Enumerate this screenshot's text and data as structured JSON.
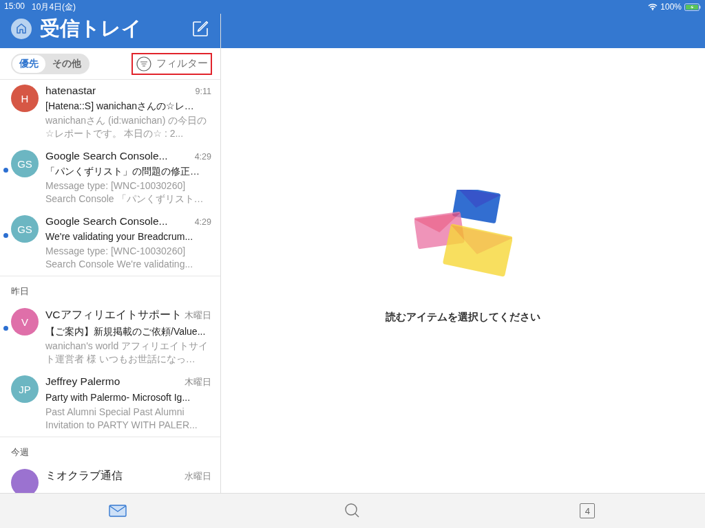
{
  "status_bar": {
    "time": "15:00",
    "date": "10月4日(金)",
    "battery": "100%"
  },
  "mail_pane": {
    "title": "受信トレイ",
    "segments": [
      {
        "label": "優先",
        "selected": true
      },
      {
        "label": "その他",
        "selected": false
      }
    ],
    "filter": {
      "label": "フィルター",
      "highlighted": true
    },
    "sections": [
      {
        "messages": [
          {
            "initials": "H",
            "color": "#d65745",
            "sender": "hatenastar",
            "time": "9:11",
            "subject": "[Hatena::S] wanichanさんの☆レ…",
            "preview": "wanichanさん (id:wanichan) の今日の☆レポートです。 本日の☆ : 2...",
            "unread": false
          },
          {
            "initials": "GS",
            "color": "#6cb6c2",
            "sender": "Google Search Console...",
            "time": "4:29",
            "subject": "「パンくずリスト」の問題の修正…",
            "preview": "Message type: [WNC-10030260] Search Console 「パンくずリスト…",
            "unread": true
          },
          {
            "initials": "GS",
            "color": "#6cb6c2",
            "sender": "Google Search Console...",
            "time": "4:29",
            "subject": "We're validating your Breadcrum...",
            "preview": "Message type: [WNC-10030260] Search Console We're validating...",
            "unread": true
          }
        ]
      },
      {
        "heading": "昨日",
        "messages": [
          {
            "initials": "V",
            "color": "#df6fa9",
            "sender": "VCアフィリエイトサポート",
            "time": "木曜日",
            "subject": "【ご案内】新規掲載のご依頼/Value...",
            "preview": "wanichan's world アフィリエイトサイト運営者 様 いつもお世話になっ…",
            "unread": true
          },
          {
            "initials": "JP",
            "color": "#6cb6c2",
            "sender": "Jeffrey Palermo",
            "time": "木曜日",
            "subject": "Party with Palermo- Microsoft Ig...",
            "preview": "Past Alumni Special Past Alumni Invitation to PARTY WITH PALER...",
            "unread": false
          }
        ]
      },
      {
        "heading": "今週",
        "messages": [
          {
            "color": "#9b72d0",
            "sender": "ミオクラブ通信",
            "time": "水曜日",
            "unread": false
          }
        ]
      }
    ]
  },
  "reading_pane": {
    "message": "読むアイテムを選択してください"
  },
  "tab_bar": [
    {
      "kind": "mail",
      "selected": true
    },
    {
      "kind": "search",
      "selected": false
    },
    {
      "kind": "calendar",
      "label": "4",
      "selected": false
    }
  ]
}
